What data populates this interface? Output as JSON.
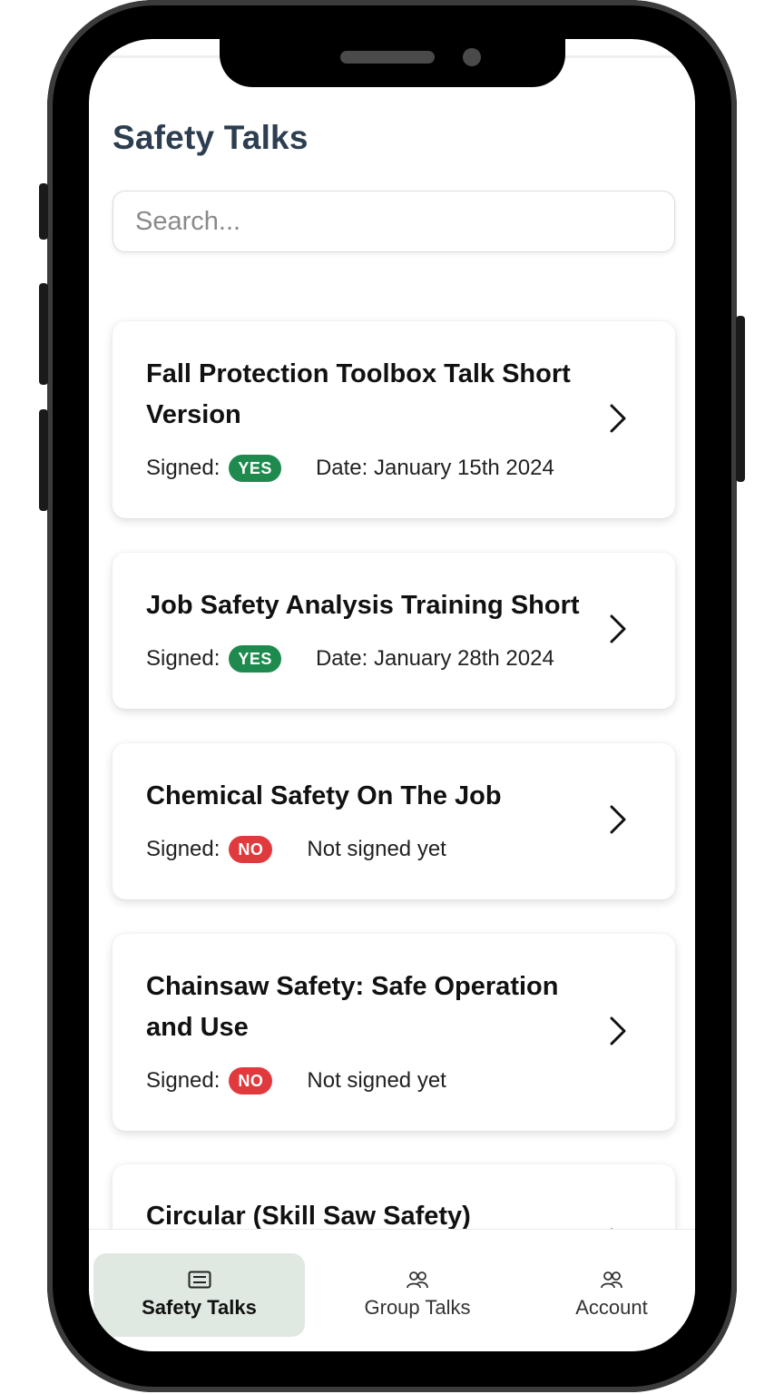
{
  "header": {
    "title": "Safety Talks"
  },
  "search": {
    "placeholder": "Search..."
  },
  "cards": [
    {
      "title": "Fall Protection Toolbox Talk Short Version",
      "signed_label": "Signed:",
      "signed": "YES",
      "status": "Date: January 15th 2024"
    },
    {
      "title": "Job Safety Analysis Training Short",
      "signed_label": "Signed:",
      "signed": "YES",
      "status": "Date: January 28th 2024"
    },
    {
      "title": "Chemical Safety On The Job",
      "signed_label": "Signed:",
      "signed": "NO",
      "status": "Not signed yet"
    },
    {
      "title": "Chainsaw Safety: Safe Operation and Use",
      "signed_label": "Signed:",
      "signed": "NO",
      "status": "Not signed yet"
    },
    {
      "title": "Circular (Skill Saw Safety)"
    }
  ],
  "tabs": [
    {
      "label": "Safety Talks",
      "icon": "list-icon",
      "active": true
    },
    {
      "label": "Group Talks",
      "icon": "users-icon",
      "active": false
    },
    {
      "label": "Account",
      "icon": "users-icon",
      "active": false
    }
  ],
  "colors": {
    "title": "#2c3e50",
    "badge_yes": "#1e8a4e",
    "badge_no": "#e03a3e",
    "active_tab_bg": "#dfe9e1"
  }
}
